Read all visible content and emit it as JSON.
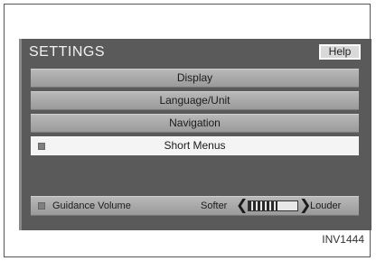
{
  "screen": {
    "title": "SETTINGS",
    "help_label": "Help"
  },
  "menu": {
    "items": [
      {
        "label": "Display"
      },
      {
        "label": "Language/Unit"
      },
      {
        "label": "Navigation"
      },
      {
        "label": "Short Menus"
      }
    ],
    "selected_index": 3
  },
  "guidance_volume": {
    "label": "Guidance Volume",
    "softer_label": "Softer",
    "louder_label": "Louder",
    "level": 0.6
  },
  "figure_code": "INV1444"
}
